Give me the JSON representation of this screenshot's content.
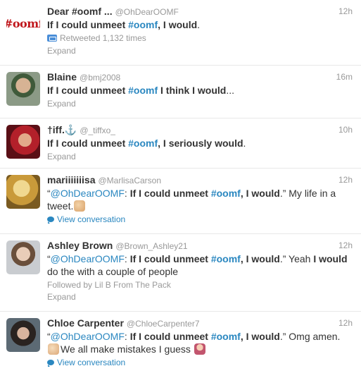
{
  "colors": {
    "link": "#2a87c0",
    "muted": "#999999",
    "text": "#333333",
    "retweet_icon": "#4a8ed8"
  },
  "tweets": [
    {
      "name": "Dear #oomf ...",
      "handle": "@OhDearOOMF",
      "time": "12h",
      "avatar_text": "#oomf",
      "text": {
        "p1": "If I could ",
        "b1": "unmeet",
        "p2": " ",
        "tag": "#oomf",
        "p3": ", ",
        "b2": "I would",
        "p4": "."
      },
      "retweeted": "Retweeted 1,132 times",
      "action": "Expand"
    },
    {
      "name": "Blaine",
      "handle": "@bmj2008",
      "time": "16m",
      "text": {
        "p1": "If I could ",
        "b1": "unmeet",
        "p2": " ",
        "tag": "#oomf",
        "p3": " I think ",
        "b2": "I would",
        "p4": "..."
      },
      "action": "Expand"
    },
    {
      "name": "†iff.⚓",
      "handle": "@_tiffxo_",
      "time": "10h",
      "text": {
        "p1": "If I could ",
        "b1": "unmeet",
        "p2": " ",
        "tag": "#oomf",
        "p3": ", I seriously ",
        "b2": "would",
        "p4": "."
      },
      "action": "Expand"
    },
    {
      "name": "mariiiiiiisa",
      "handle": "@MarlisaCarson",
      "time": "12h",
      "text": {
        "q1": "“",
        "mention": "@OhDearOOMF",
        "c1": ": ",
        "p1": "If I could ",
        "b1": "unmeet",
        "p2": " ",
        "tag": "#oomf",
        "p3": ", ",
        "b2": "I would",
        "p4": ".” My life in a tweet."
      },
      "action": "View conversation"
    },
    {
      "name": "Ashley Brown",
      "handle": "@Brown_Ashley21",
      "time": "12h",
      "text": {
        "q1": "“",
        "mention": "@OhDearOOMF",
        "c1": ": ",
        "p1": "If I could ",
        "b1": "unmeet",
        "p2": " ",
        "tag": "#oomf",
        "p3": ", ",
        "b2": "I would",
        "p4": ".” Yeah ",
        "b3": "I would",
        "p5": " do the with a couple of people"
      },
      "followed": "Followed by Lil B From The Pack",
      "action": "Expand"
    },
    {
      "name": "Chloe Carpenter",
      "handle": "@ChloeCarpenter7",
      "time": "12h",
      "text": {
        "q1": "“",
        "mention": "@OhDearOOMF",
        "c1": ": ",
        "p1": "If I could ",
        "b1": "unmeet",
        "p2": " ",
        "tag": "#oomf",
        "p3": ", ",
        "b2": "I would",
        "p4": ".” Omg amen. ",
        "p5": "We all make mistakes I guess "
      },
      "action": "View conversation"
    }
  ]
}
